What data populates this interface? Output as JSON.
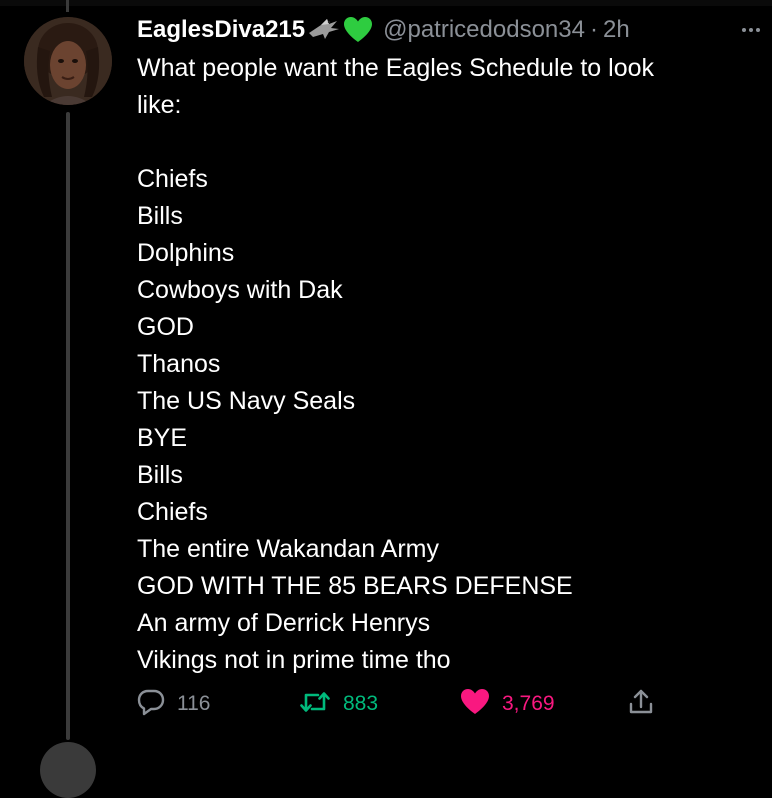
{
  "tweet": {
    "display_name": "EaglesDiva215",
    "name_emojis": [
      "eagle-emoji",
      "green-heart-emoji"
    ],
    "handle": "@patricedodson34",
    "separator": "·",
    "time": "2h",
    "text_lines": [
      "What people want the Eagles Schedule to look",
      "like:",
      "",
      "Chiefs",
      "Bills",
      "Dolphins",
      "Cowboys with Dak",
      "GOD",
      "Thanos",
      "The US Navy Seals",
      "BYE",
      "Bills",
      "Chiefs",
      "The entire Wakandan Army",
      "GOD WITH THE 85 BEARS DEFENSE",
      "An army of Derrick Henrys",
      "Vikings not in prime time tho"
    ],
    "stats": {
      "replies": "116",
      "retweets": "883",
      "likes": "3,769"
    },
    "colors": {
      "background": "#000000",
      "text": "#ffffff",
      "muted": "#8b9097",
      "retweet": "#00ba7c",
      "like": "#f91880",
      "heart_emoji": "#2ecc40"
    }
  }
}
